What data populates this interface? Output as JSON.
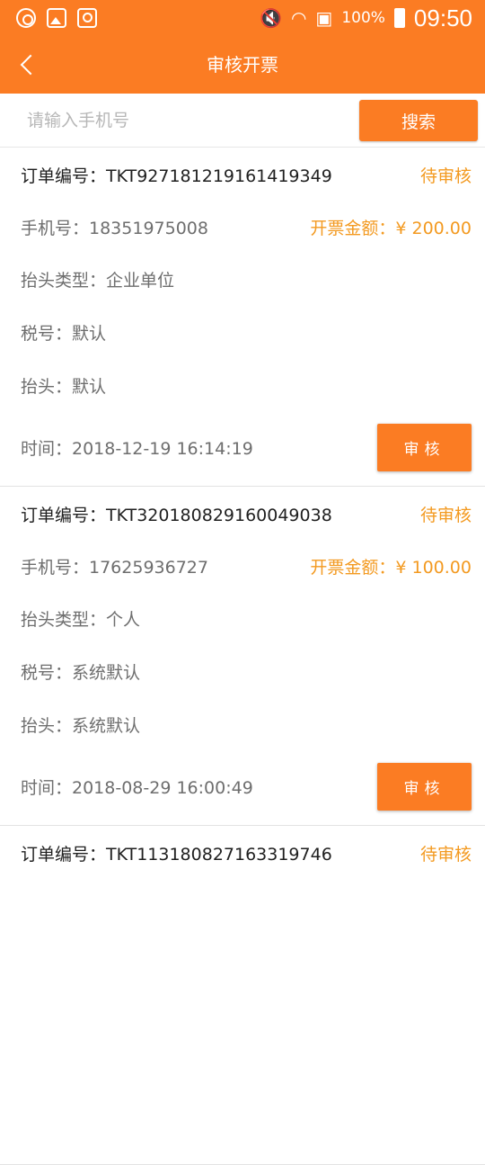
{
  "status_bar": {
    "battery_text": "100%",
    "time": "09:50",
    "icons": [
      "at-circle-icon",
      "gallery-icon",
      "search-square-icon",
      "mute-icon",
      "wifi-icon",
      "sim-icon",
      "battery-icon"
    ]
  },
  "header": {
    "title": "审核开票",
    "back_icon": "chevron-left-icon",
    "background": "#fb7c23"
  },
  "search": {
    "placeholder": "请输入手机号",
    "value": "",
    "button_label": "搜索"
  },
  "orders": [
    {
      "order_no": "订单编号：TKT927181219161419349",
      "status": "待审核",
      "phone": "手机号：18351975008",
      "amount": "开票金额：¥ 200.00",
      "title_type": "抬头类型：企业单位",
      "tax_no": "税号：默认",
      "invoice_title": "抬头：默认",
      "time": "时间：2018-12-19 16:14:19",
      "action_label": "审核"
    },
    {
      "order_no": "订单编号：TKT320180829160049038",
      "status": "待审核",
      "phone": "手机号：17625936727",
      "amount": "开票金额：¥ 100.00",
      "title_type": "抬头类型：个人",
      "tax_no": "税号：系统默认",
      "invoice_title": "抬头：系统默认",
      "time": "时间：2018-08-29 16:00:49",
      "action_label": "审核"
    },
    {
      "order_no": "订单编号：TKT113180827163319746",
      "status": "待审核"
    }
  ],
  "colors": {
    "accent": "#fb7c23",
    "status": "#f39a21"
  }
}
